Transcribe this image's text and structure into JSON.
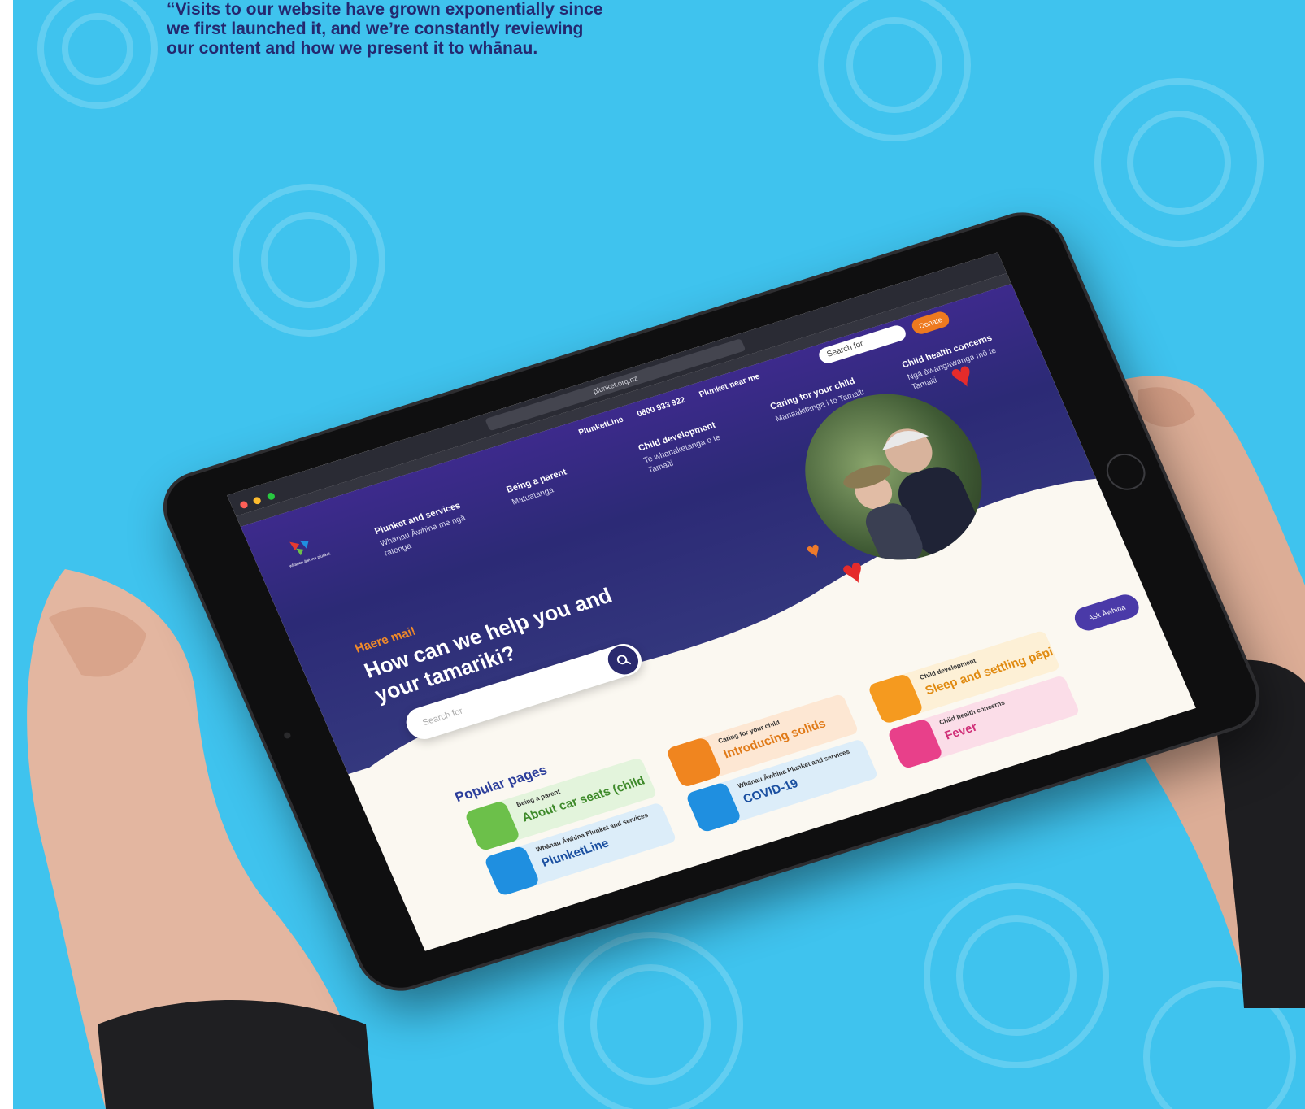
{
  "quote": {
    "lines": [
      "“Visits to our website have grown exponentially since",
      "we first launched it, and we’re constantly reviewing",
      "our content and how we present it to whānau."
    ]
  },
  "browser": {
    "url": "plunket.org.nz"
  },
  "site": {
    "utility": {
      "plunketline": "PlunketLine",
      "phone": "0800 933 922",
      "near_me": "Plunket near me",
      "search_placeholder": "Search for",
      "donate": "Donate"
    },
    "logo_text": "whānau āwhina plunket",
    "nav": [
      {
        "title": "Plunket and services",
        "sub": "Whānau Āwhina me ngā ratonga"
      },
      {
        "title": "Being a parent",
        "sub": "Matuatanga"
      },
      {
        "title": "Child development",
        "sub": "Te whanaketanga o te Tamaiti"
      },
      {
        "title": "Caring for your child",
        "sub": "Manaakitanga i tō Tamaiti"
      },
      {
        "title": "Child health concerns",
        "sub": "Ngā āwangawanga mō te Tamaiti"
      }
    ],
    "hero": {
      "greeting": "Haere mai!",
      "headline": "How can we help you and your tamariki?",
      "search_placeholder": "Search for"
    },
    "popular": {
      "title": "Popular pages",
      "cards": [
        {
          "category": "Being a parent",
          "title": "About car seats (child",
          "color": "#6cc04a",
          "bg": "#e3f4dc",
          "title_color": "#3e8a2a"
        },
        {
          "category": "Whānau Āwhina Plunket and services",
          "title": "PlunketLine",
          "color": "#1f8fe0",
          "bg": "#dcedf9",
          "title_color": "#1a4fa0"
        },
        {
          "category": "Caring for your child",
          "title": "Introducing solids",
          "color": "#f0851f",
          "bg": "#fde7d3",
          "title_color": "#e07a18"
        },
        {
          "category": "Whānau Āwhina Plunket and services",
          "title": "COVID-19",
          "color": "#1f8fe0",
          "bg": "#dcedf9",
          "title_color": "#1a4fa0"
        },
        {
          "category": "Child development",
          "title": "Sleep and settling pēpi",
          "color": "#f59a1f",
          "bg": "#fdf0d6",
          "title_color": "#e08a10"
        },
        {
          "category": "Child health concerns",
          "title": "Fever",
          "color": "#e8408a",
          "bg": "#fbdde8",
          "title_color": "#d02f78"
        }
      ]
    },
    "ask": "Ask Āwhina"
  },
  "colors": {
    "background": "#3fc3ee",
    "quote_text": "#24286f",
    "hero_navy": "#2c2a76"
  }
}
